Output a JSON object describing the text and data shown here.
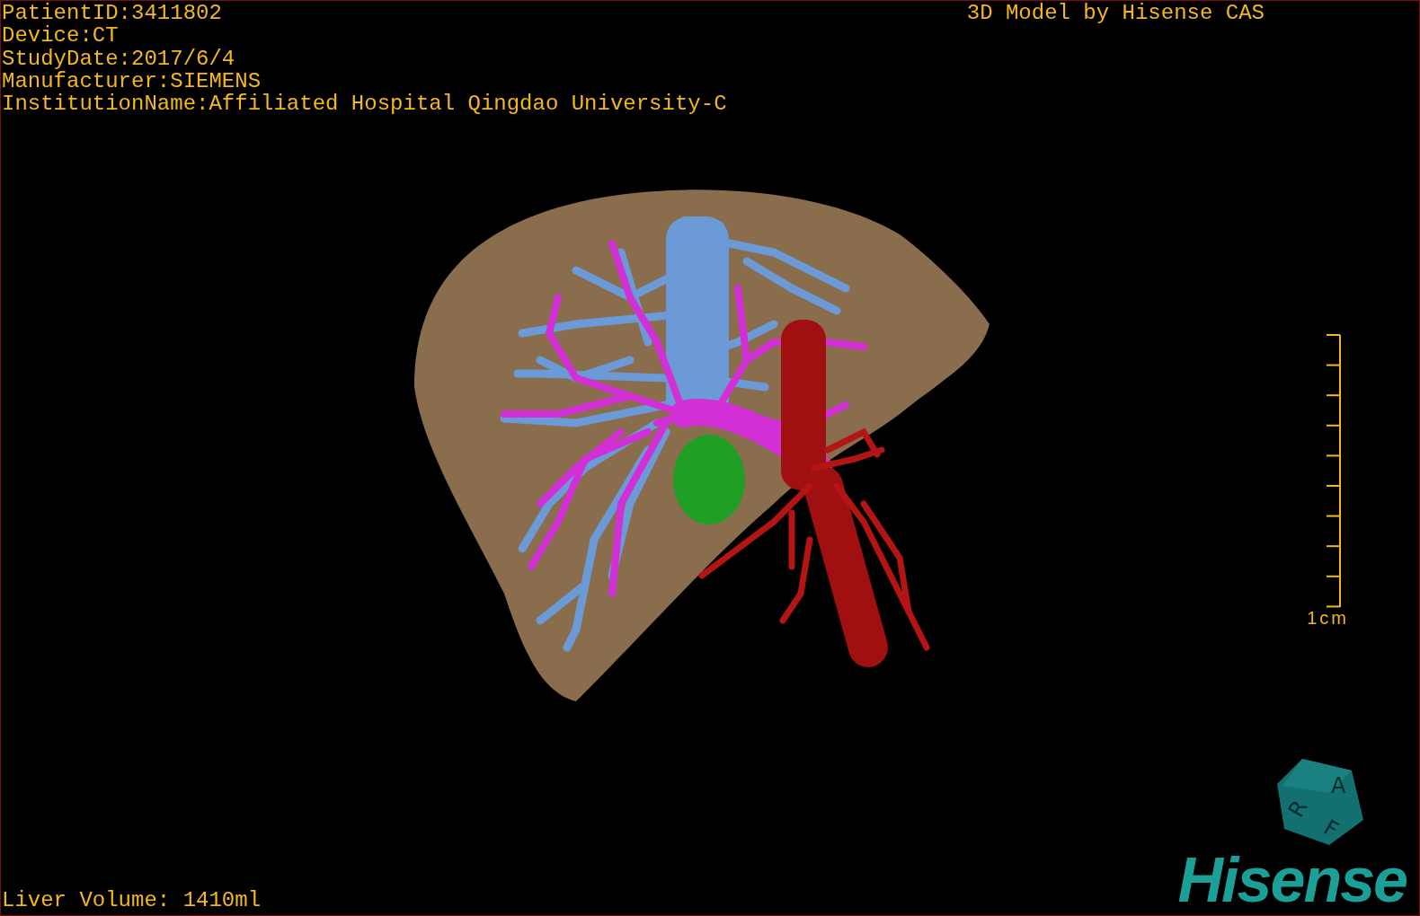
{
  "info_lines": [
    "PatientID:3411802",
    "Device:CT",
    "StudyDate:2017/6/4",
    "Manufacturer:SIEMENS",
    "InstitutionName:Affiliated Hospital Qingdao University-C"
  ],
  "title": "3D Model by Hisense CAS",
  "scale_bar": {
    "label": "1cm"
  },
  "liver_volume": "Liver Volume: 1410ml",
  "orientation_cube": {
    "top_face": "A",
    "left_face": "R",
    "front_face": "F"
  },
  "logo": "Hisense"
}
